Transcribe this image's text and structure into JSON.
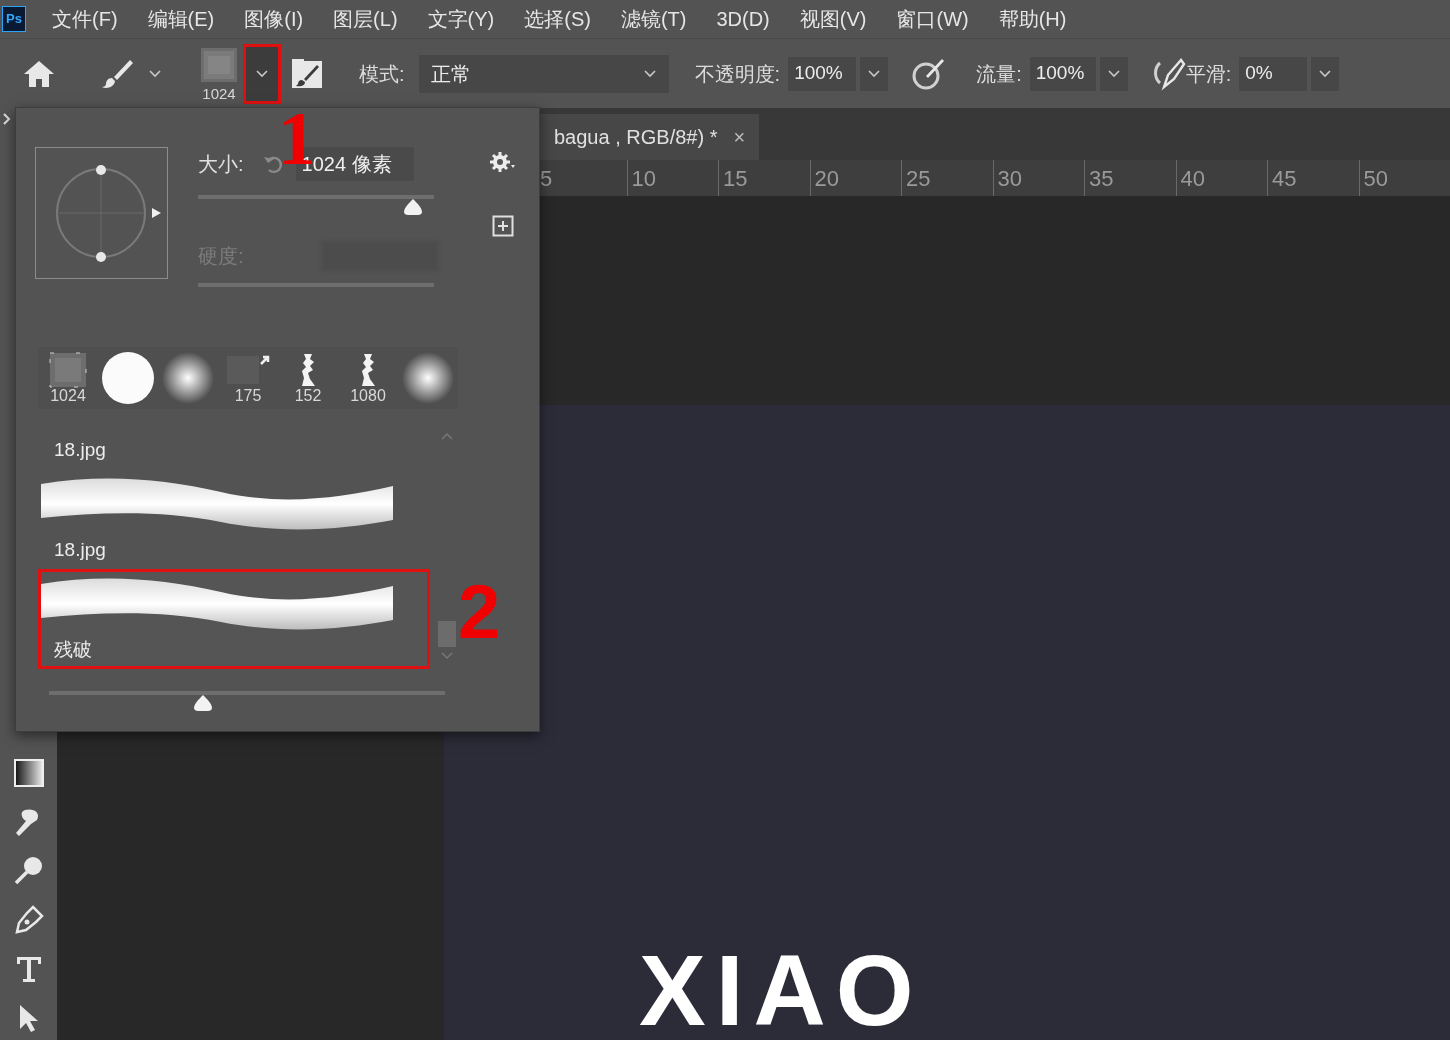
{
  "menu": {
    "logo": "Ps",
    "items": [
      "文件(F)",
      "编辑(E)",
      "图像(I)",
      "图层(L)",
      "文字(Y)",
      "选择(S)",
      "滤镜(T)",
      "3D(D)",
      "视图(V)",
      "窗口(W)",
      "帮助(H)"
    ]
  },
  "options": {
    "preset_size": "1024",
    "mode_label": "模式:",
    "mode": "正常",
    "opacity_label": "不透明度:",
    "opacity": "100%",
    "flow_label": "流量:",
    "flow": "100%",
    "smoothing_label": "平滑:",
    "smoothing": "0%"
  },
  "document_tab": {
    "title": "bagua , RGB/8#) *",
    "close": "×"
  },
  "ruler": [
    "5",
    "10",
    "15",
    "20",
    "25",
    "30",
    "35",
    "40",
    "45",
    "50"
  ],
  "brush_picker": {
    "size_label": "大小:",
    "size": "1024 像素",
    "size_slider": {
      "level": 0.91
    },
    "hardness_label": "硬度:",
    "hardness_disabled": true,
    "tips": [
      {
        "kind": "square",
        "label": "1024"
      },
      {
        "kind": "hard"
      },
      {
        "kind": "soft"
      },
      {
        "kind": "texture",
        "label": "175"
      },
      {
        "kind": "figure",
        "label": "152"
      },
      {
        "kind": "figure",
        "label": "1080"
      },
      {
        "kind": "soft"
      }
    ],
    "presets": [
      {
        "kind": "name_only",
        "name": "18.jpg",
        "selected": false
      },
      {
        "kind": "stroke",
        "name": "18.jpg",
        "selected": false
      },
      {
        "kind": "stroke",
        "name": "残破",
        "selected": true
      }
    ],
    "preview_size": {
      "level": 0.39
    }
  },
  "document": {
    "text": "XIAO"
  },
  "annotations": [
    "1",
    "2"
  ]
}
